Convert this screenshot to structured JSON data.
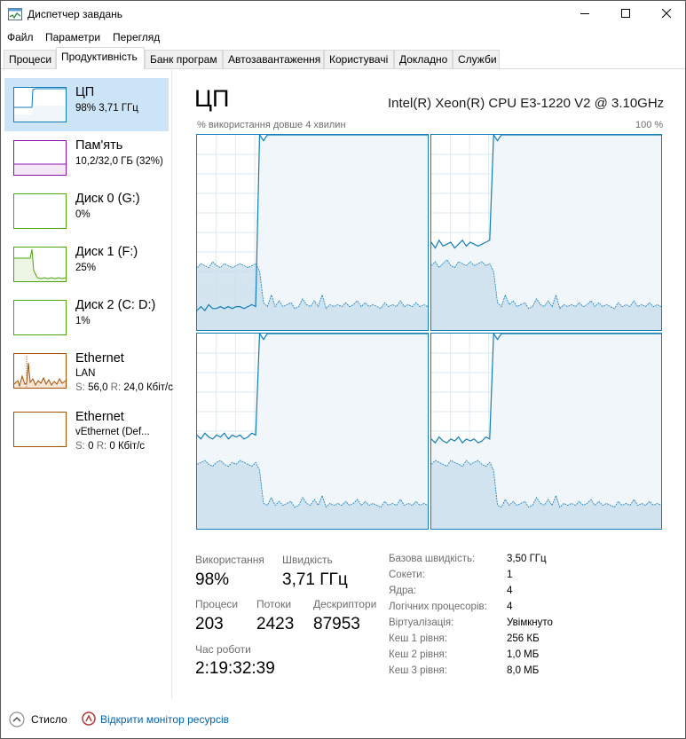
{
  "window": {
    "title": "Диспетчер завдань"
  },
  "menu": [
    "Файл",
    "Параметри",
    "Перегляд"
  ],
  "tabs": [
    "Процеси",
    "Продуктивність",
    "Банк програм",
    "Автозавантаження",
    "Користувачі",
    "Докладно",
    "Служби"
  ],
  "active_tab": 1,
  "sidebar": [
    {
      "title": "ЦП",
      "line1": "98% 3,71 ГГц",
      "color": "#117dbb",
      "selected": true
    },
    {
      "title": "Пам'ять",
      "line1": "10,2/32,0 ГБ (32%)",
      "color": "#8b12ae"
    },
    {
      "title": "Диск 0 (G:)",
      "line1": "0%",
      "color": "#4da60c"
    },
    {
      "title": "Диск 1 (F:)",
      "line1": "25%",
      "color": "#4da60c"
    },
    {
      "title": "Диск 2 (C: D:)",
      "line1": "1%",
      "color": "#4da60c"
    },
    {
      "title": "Ethernet",
      "line1": "LAN",
      "line2": {
        "s_label": "S:",
        "s_value": "56,0",
        "r_label": "R:",
        "r_value": "24,0 Кбіт/с"
      },
      "color": "#a74f01"
    },
    {
      "title": "Ethernet",
      "line1": "vEthernet (Def...",
      "line2": {
        "s_label": "S:",
        "s_value": "0",
        "r_label": "R:",
        "r_value": "0 Кбіт/с"
      },
      "color": "#a74f01"
    }
  ],
  "main": {
    "title": "ЦП",
    "cpu_name": "Intel(R) Xeon(R) CPU E3-1220 V2 @ 3.10GHz",
    "axis_left": "% використання довше 4 хвилин",
    "axis_right": "100 %"
  },
  "colors": {
    "cpu_line": "#117dbb",
    "cpu_fill": "#f1f6fa",
    "cpu_kernel": "#c6dceb",
    "grid": "#d9eaf4",
    "selected_bg": "#cce4f7"
  },
  "stats": {
    "usage_label": "Використання",
    "usage_value": "98%",
    "speed_label": "Швидкість",
    "speed_value": "3,71 ГГц",
    "processes_label": "Процеси",
    "processes_value": "203",
    "threads_label": "Потоки",
    "threads_value": "2423",
    "handles_label": "Дескриптори",
    "handles_value": "87953",
    "uptime_label": "Час роботи",
    "uptime_value": "2:19:32:39"
  },
  "info": [
    {
      "label": "Базова швидкість:",
      "value": "3,50 ГГц"
    },
    {
      "label": "Сокети:",
      "value": "1"
    },
    {
      "label": "Ядра:",
      "value": "4"
    },
    {
      "label": "Логічних процесорів:",
      "value": "4"
    },
    {
      "label": "Віртуалізація:",
      "value": "Увімкнуто"
    },
    {
      "label": "Кеш 1 рівня:",
      "value": "256 КБ"
    },
    {
      "label": "Кеш 2 рівня:",
      "value": "1,0 МБ"
    },
    {
      "label": "Кеш 3 рівня:",
      "value": "8,0 МБ"
    }
  ],
  "footer": {
    "fewer": "Стисло",
    "resmon": "Відкрити монітор ресурсів"
  },
  "icons": {
    "app": "task-manager-icon",
    "minimize": "minimize-icon",
    "maximize": "maximize-icon",
    "close": "close-icon",
    "fewer": "chevron-up-icon",
    "resmon": "resource-monitor-icon"
  },
  "cpu_graphs": [
    {
      "core": 0,
      "total": [
        10,
        12,
        10,
        13,
        11,
        11,
        12,
        11,
        12,
        11,
        12,
        12,
        11,
        12,
        13,
        12,
        100,
        97,
        100,
        100,
        100,
        100,
        100,
        100,
        100,
        100,
        100,
        100,
        100,
        100,
        100,
        100,
        100,
        100,
        100,
        100,
        100,
        100,
        100,
        100,
        100,
        100,
        100,
        100,
        100,
        100,
        100,
        100,
        100,
        100,
        100,
        100,
        100,
        100,
        100,
        100,
        100,
        100,
        100,
        100
      ],
      "kernel": [
        32,
        34,
        33,
        32,
        35,
        33,
        32,
        34,
        33,
        32,
        33,
        34,
        33,
        32,
        33,
        34,
        30,
        14,
        12,
        18,
        12,
        15,
        12,
        13,
        14,
        11,
        12,
        16,
        13,
        12,
        15,
        12,
        18,
        11,
        13,
        12,
        13,
        12,
        14,
        12,
        13,
        15,
        12,
        14,
        12,
        13,
        12,
        11,
        14,
        12,
        13,
        12,
        15,
        12,
        13,
        12,
        14,
        12,
        13,
        12
      ]
    },
    {
      "core": 1,
      "total": [
        45,
        42,
        46,
        43,
        44,
        45,
        42,
        44,
        46,
        43,
        45,
        44,
        43,
        44,
        45,
        46,
        100,
        97,
        100,
        100,
        100,
        100,
        100,
        100,
        100,
        100,
        100,
        100,
        100,
        100,
        100,
        100,
        100,
        100,
        100,
        100,
        100,
        100,
        100,
        100,
        100,
        100,
        100,
        100,
        100,
        100,
        100,
        100,
        100,
        100,
        100,
        100,
        100,
        100,
        100,
        100,
        100,
        100,
        100,
        100
      ],
      "kernel": [
        33,
        35,
        32,
        34,
        36,
        33,
        32,
        35,
        34,
        33,
        35,
        33,
        34,
        35,
        33,
        34,
        30,
        14,
        12,
        18,
        13,
        15,
        12,
        13,
        14,
        11,
        12,
        16,
        13,
        12,
        15,
        12,
        18,
        11,
        13,
        12,
        13,
        12,
        14,
        12,
        13,
        15,
        12,
        14,
        12,
        13,
        12,
        11,
        14,
        12,
        13,
        12,
        15,
        12,
        13,
        12,
        14,
        12,
        13,
        12
      ]
    },
    {
      "core": 2,
      "total": [
        48,
        46,
        49,
        47,
        46,
        48,
        47,
        49,
        46,
        48,
        47,
        48,
        46,
        47,
        49,
        48,
        100,
        97,
        100,
        100,
        100,
        100,
        100,
        100,
        100,
        100,
        100,
        100,
        100,
        100,
        100,
        100,
        100,
        100,
        100,
        100,
        100,
        100,
        100,
        100,
        100,
        100,
        100,
        100,
        100,
        100,
        100,
        100,
        100,
        100,
        100,
        100,
        100,
        100,
        100,
        100,
        100,
        100,
        100,
        100
      ],
      "kernel": [
        33,
        34,
        35,
        33,
        32,
        34,
        35,
        33,
        32,
        34,
        33,
        35,
        34,
        33,
        32,
        34,
        30,
        13,
        12,
        16,
        12,
        14,
        12,
        13,
        14,
        11,
        12,
        16,
        13,
        12,
        15,
        12,
        17,
        11,
        13,
        12,
        13,
        12,
        14,
        12,
        13,
        15,
        12,
        14,
        12,
        13,
        12,
        11,
        14,
        12,
        13,
        12,
        15,
        12,
        13,
        12,
        14,
        12,
        13,
        12
      ]
    },
    {
      "core": 3,
      "total": [
        46,
        44,
        47,
        45,
        44,
        46,
        45,
        47,
        44,
        46,
        45,
        46,
        44,
        45,
        47,
        46,
        100,
        97,
        100,
        100,
        100,
        100,
        100,
        100,
        100,
        100,
        100,
        100,
        100,
        100,
        100,
        100,
        100,
        100,
        100,
        100,
        100,
        100,
        100,
        100,
        100,
        100,
        100,
        100,
        100,
        100,
        100,
        100,
        100,
        100,
        100,
        100,
        100,
        100,
        100,
        100,
        100,
        100,
        100,
        100
      ],
      "kernel": [
        33,
        35,
        34,
        33,
        32,
        35,
        34,
        33,
        32,
        35,
        33,
        34,
        35,
        33,
        32,
        34,
        30,
        12,
        11,
        15,
        12,
        14,
        12,
        13,
        14,
        11,
        12,
        16,
        13,
        12,
        15,
        12,
        17,
        11,
        13,
        12,
        13,
        12,
        14,
        12,
        13,
        15,
        12,
        14,
        12,
        13,
        12,
        11,
        14,
        12,
        13,
        12,
        15,
        12,
        13,
        12,
        14,
        12,
        13,
        12
      ]
    }
  ]
}
